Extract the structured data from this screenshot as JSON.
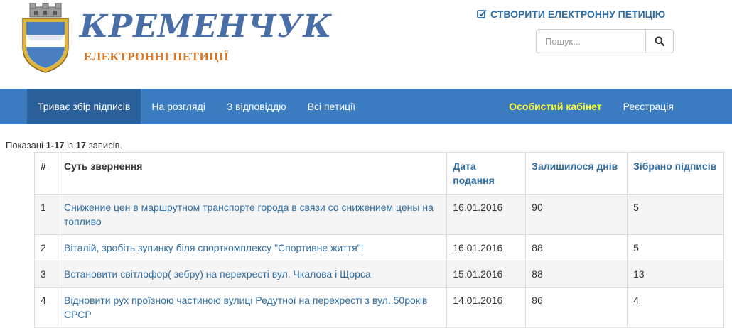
{
  "header": {
    "city_name": "КРЕМЕНЧУК",
    "subtitle": "ЕЛЕКТРОННІ ПЕТИЦІЇ",
    "create_petition": "СТВОРИТИ ЕЛЕКТРОННУ ПЕТИЦІЮ",
    "search_placeholder": "Пошук..."
  },
  "nav": {
    "left": [
      "Триває збір підписів",
      "На розгляді",
      "З відповіддю",
      "Всі петиції"
    ],
    "cabinet": "Особистий кабінет",
    "register": "Реєстрація"
  },
  "summary": {
    "prefix": "Показані ",
    "range": "1-17",
    "middle": " із ",
    "total": "17",
    "suffix": " записів."
  },
  "table": {
    "headers": [
      "#",
      "Суть звернення",
      "Дата подання",
      "Залишилося днів",
      "Зібрано підписів"
    ],
    "rows": [
      [
        "1",
        "Снижение цен в маршрутном транспорте города в связи со снижением цены на топливо",
        "16.01.2016",
        "90",
        "5"
      ],
      [
        "2",
        "Віталій, зробіть зупинку біля спорткомплексу \"Спортивне життя\"!",
        "16.01.2016",
        "88",
        "5"
      ],
      [
        "3",
        "Встановити світлофор( зебру) на перехресті вул. Чкалова і Щорса",
        "15.01.2016",
        "88",
        "13"
      ],
      [
        "4",
        "Відновити рух проїзною частиною вулиці Редутної на перехресті з вул. 50років СРСР",
        "14.01.2016",
        "86",
        "4"
      ]
    ]
  },
  "colors": {
    "navbar": "#3b7bbf",
    "navbar_active": "#2b5f99",
    "link": "#2e6da4",
    "cabinet": "#ffff33",
    "subtitle": "#d9782a"
  }
}
